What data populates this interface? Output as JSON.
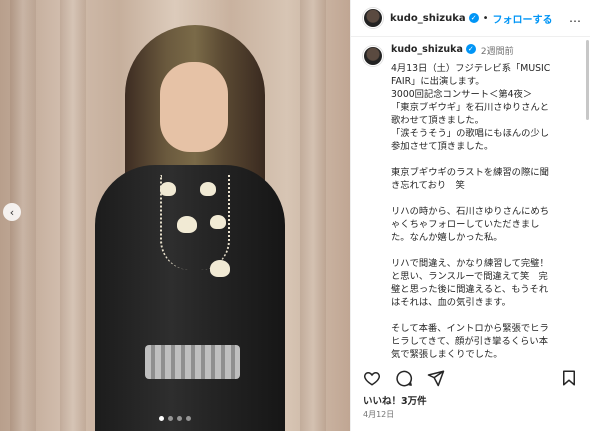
{
  "post": {
    "username": "kudo_shizuka",
    "separator": "•",
    "follow_label": "フォローする",
    "more_label": "…",
    "time_ago": "2週間前",
    "caption_lines": [
      "4月13日（土）フジテレビ系「MUSIC",
      "FAIR」に出演します。",
      "3000回記念コンサート＜第4夜＞",
      "「東京ブギウギ」を石川さゆりさんと",
      "歌わせて頂きました。",
      "「涙そうそう」の歌唱にもほんの少し",
      "参加させて頂きました。",
      "",
      "東京ブギウギのラストを練習の際に聞",
      "き忘れており　笑",
      "",
      "リハの時から、石川さゆりさんにめち",
      "ゃくちゃフォローしていただきまし",
      "た。なんか嬉しかった私。",
      "",
      "リハで間違え、かなり練習して完璧！",
      "と思い、ランスルーで間違えて笑　完",
      "璧と思った後に間違えると、もうそれ",
      "はそれは、血の気引きます。",
      "",
      "そして本番、イントロから緊張でヒラ",
      "ヒラしてきて、顔が引き攣るくらい本",
      "気で緊張しまくりでした。"
    ],
    "likes": "いいね！3万件",
    "date": "4月12日"
  },
  "carousel": {
    "slides": 4,
    "active_index": 0,
    "prev_icon": "‹"
  },
  "icons": {
    "heart": "heart-icon",
    "comment": "comment-icon",
    "share": "share-icon",
    "bookmark": "bookmark-icon"
  },
  "colors": {
    "accent": "#0095f6",
    "text": "#262626",
    "muted": "#737373"
  }
}
